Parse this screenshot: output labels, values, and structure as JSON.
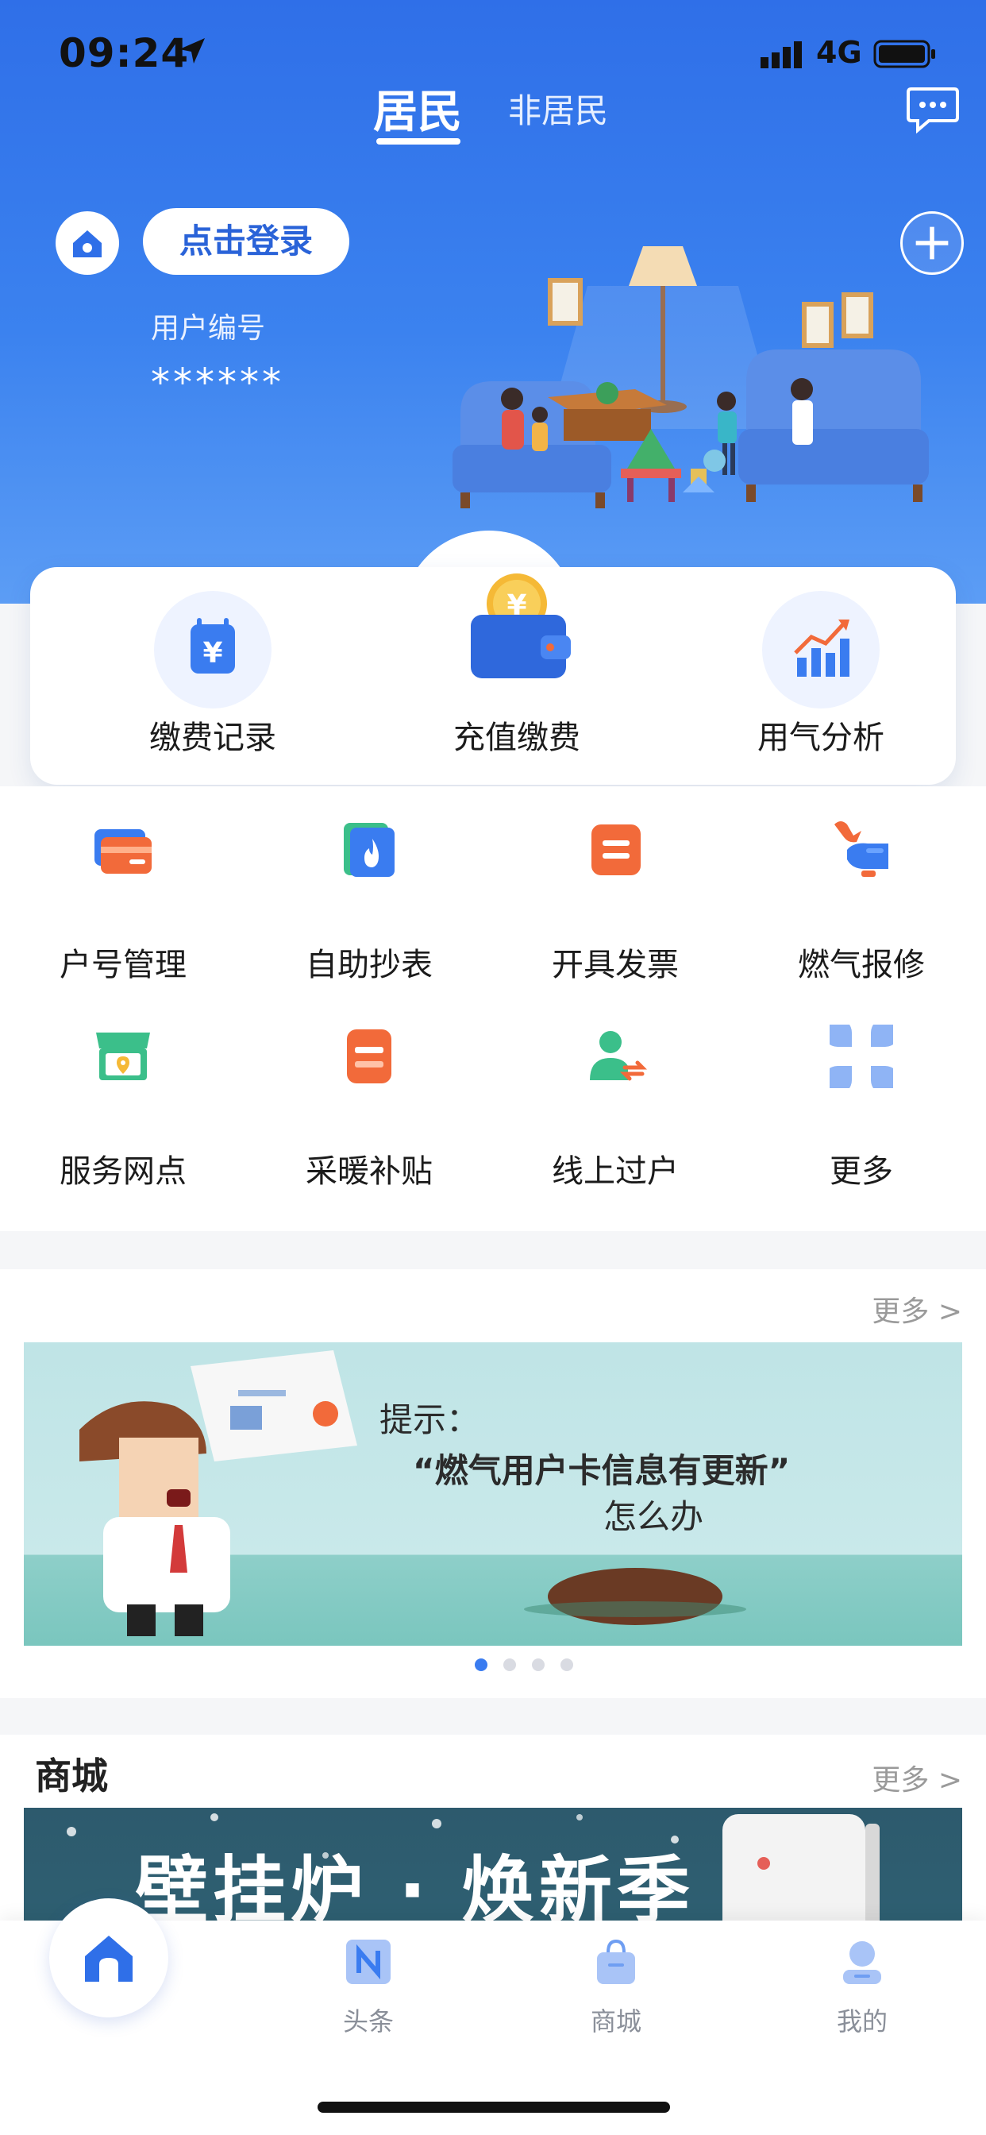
{
  "status_bar": {
    "time": "09:24",
    "network": "4G"
  },
  "header": {
    "tabs": [
      {
        "label": "居民",
        "active": true
      },
      {
        "label": "非居民",
        "active": false
      }
    ],
    "login_label": "点击登录",
    "user_no_label": "用户编号",
    "user_no_value": "******"
  },
  "quick_actions": [
    {
      "label": "缴费记录",
      "icon": "payment-record-icon"
    },
    {
      "label": "充值缴费",
      "icon": "wallet-icon"
    },
    {
      "label": "用气分析",
      "icon": "chart-icon"
    }
  ],
  "services": [
    {
      "label": "户号管理",
      "icon": "card-icon"
    },
    {
      "label": "自助抄表",
      "icon": "flame-icon"
    },
    {
      "label": "开具发票",
      "icon": "invoice-icon"
    },
    {
      "label": "燃气报修",
      "icon": "repair-icon"
    },
    {
      "label": "服务网点",
      "icon": "store-icon"
    },
    {
      "label": "采暖补贴",
      "icon": "subsidy-icon"
    },
    {
      "label": "线上过户",
      "icon": "transfer-icon"
    },
    {
      "label": "更多",
      "icon": "more-grid-icon"
    }
  ],
  "banner": {
    "more_label": "更多 >",
    "line1": "提示：",
    "line2": "“燃气用户卡信息有更新”",
    "line3": "怎么办",
    "dot_count": 4,
    "active_dot": 0
  },
  "mall": {
    "title": "商城",
    "more_label": "更多 >",
    "banner_text": "壁挂炉 · 焕新季"
  },
  "tab_bar": [
    {
      "label": "",
      "icon": "home-icon",
      "active": true
    },
    {
      "label": "头条",
      "icon": "news-icon",
      "active": false
    },
    {
      "label": "商城",
      "icon": "shopping-bag-icon",
      "active": false
    },
    {
      "label": "我的",
      "icon": "profile-icon",
      "active": false
    }
  ],
  "colors": {
    "primary": "#3a7cf0",
    "accent_orange": "#f26a3a",
    "accent_green": "#3bbf8a"
  }
}
